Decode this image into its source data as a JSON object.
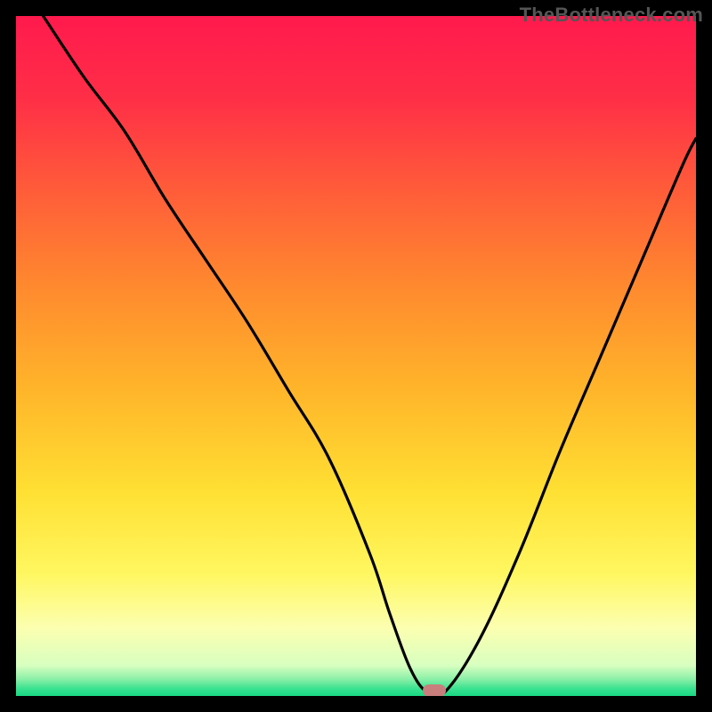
{
  "watermark": "TheBottleneck.com",
  "colors": {
    "frame": "#000000",
    "curve": "#000000",
    "marker": "#c97e7e",
    "watermark_text": "#555555"
  },
  "gradient_stops": [
    {
      "offset": 0.0,
      "color": "#ff1a4d"
    },
    {
      "offset": 0.12,
      "color": "#ff2e47"
    },
    {
      "offset": 0.25,
      "color": "#ff5a3a"
    },
    {
      "offset": 0.4,
      "color": "#ff8a2e"
    },
    {
      "offset": 0.55,
      "color": "#ffb52a"
    },
    {
      "offset": 0.7,
      "color": "#ffe033"
    },
    {
      "offset": 0.82,
      "color": "#fff760"
    },
    {
      "offset": 0.9,
      "color": "#fcffb0"
    },
    {
      "offset": 0.955,
      "color": "#d8ffc0"
    },
    {
      "offset": 0.975,
      "color": "#8cf0a8"
    },
    {
      "offset": 0.99,
      "color": "#35e18e"
    },
    {
      "offset": 1.0,
      "color": "#19d884"
    }
  ],
  "chart_data": {
    "type": "line",
    "title": "",
    "xlabel": "",
    "ylabel": "",
    "xlim": [
      0,
      100
    ],
    "ylim": [
      0,
      100
    ],
    "grid": false,
    "series": [
      {
        "name": "bottleneck-curve",
        "x": [
          4,
          10,
          16,
          22,
          28,
          34,
          40,
          46,
          52,
          55,
          58,
          60.5,
          63,
          68,
          74,
          80,
          86,
          92,
          98,
          100
        ],
        "y": [
          100,
          91,
          83,
          73,
          64,
          55,
          45,
          35,
          21,
          12,
          4,
          0.5,
          0.5,
          8,
          21,
          36,
          50,
          64,
          78,
          82
        ]
      }
    ],
    "annotations": [
      {
        "name": "optimal-marker",
        "x": 61.5,
        "y": 0.8
      }
    ]
  }
}
